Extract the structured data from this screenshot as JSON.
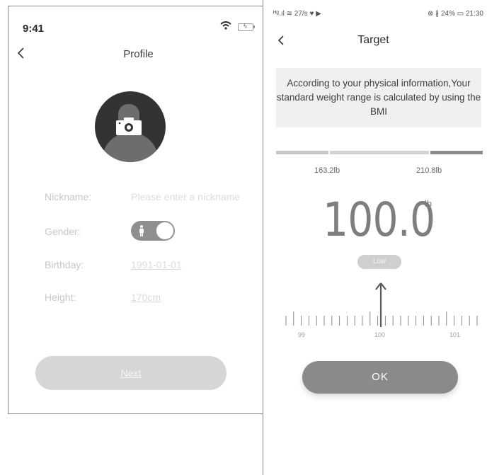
{
  "profile_screen": {
    "status_time": "9:41",
    "title": "Profile",
    "fields": [
      {
        "label": "Nickname:",
        "value": "Please enter a nickname"
      },
      {
        "label": "Gender:"
      },
      {
        "label": "Birthday:",
        "value": "1991-01-01"
      },
      {
        "label": "Height:",
        "value": "170cm"
      }
    ],
    "next_label": "Next"
  },
  "target_screen": {
    "status_left": "ᴴᵍ.ıl ≋ 27/s ♥ ▶",
    "status_right": "⊗ ∦ 24% ▭ 21:30",
    "title": "Target",
    "info_text": "According to your physical information,Your standard weight range is calculated by using the BMI",
    "range_low": "163.2lb",
    "range_high": "210.8lb",
    "weight": "100.0",
    "unit": "lb",
    "status_badge": "Low",
    "ruler_labels": [
      "99",
      "100",
      "101"
    ],
    "ok_label": "OK"
  }
}
